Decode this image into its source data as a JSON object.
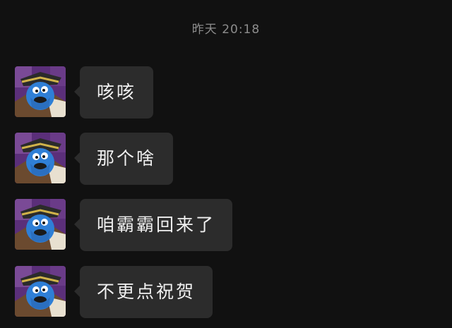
{
  "chat": {
    "timestamp": "昨天 20:18",
    "messages": [
      {
        "text": "咳咳",
        "avatar_icon": "cookie-monster-pirate-avatar"
      },
      {
        "text": "那个啥",
        "avatar_icon": "cookie-monster-pirate-avatar"
      },
      {
        "text": "咱霸霸回来了",
        "avatar_icon": "cookie-monster-pirate-avatar"
      },
      {
        "text": "不更点祝贺",
        "avatar_icon": "cookie-monster-pirate-avatar"
      }
    ]
  },
  "colors": {
    "background": "#111111",
    "bubble": "#2c2c2c",
    "bubble_text": "#f0f0f0",
    "timestamp": "#8d8d8d",
    "avatar_purple": "#5b2f7a",
    "monster_blue": "#2f7fd6"
  }
}
